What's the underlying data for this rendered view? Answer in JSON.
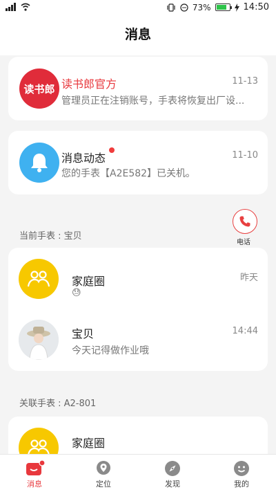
{
  "status_bar": {
    "battery": "73%",
    "time": "14:50"
  },
  "header": {
    "title": "消息"
  },
  "notices": [
    {
      "name": "读书郎官方",
      "avatar_text": "读书郎",
      "time": "11-13",
      "preview": "管理员正在注销账号，手表将恢复出厂设..."
    },
    {
      "name": "消息动态",
      "time": "11-10",
      "preview": "您的手表【A2E582】已关机。"
    }
  ],
  "current_watch": {
    "label": "当前手表 : 宝贝",
    "call_label": "电话",
    "chats": [
      {
        "name": "家庭圈",
        "time": "昨天",
        "preview": "😓"
      },
      {
        "name": "宝贝",
        "time": "14:44",
        "preview": "今天记得做作业哦"
      }
    ]
  },
  "linked_watch": {
    "label": "关联手表 : A2-801",
    "chats": [
      {
        "name": "家庭圈"
      }
    ]
  },
  "tabs": [
    {
      "label": "消息",
      "icon": "message-icon",
      "active": true
    },
    {
      "label": "定位",
      "icon": "location-icon",
      "active": false
    },
    {
      "label": "发现",
      "icon": "compass-icon",
      "active": false
    },
    {
      "label": "我的",
      "icon": "smiley-icon",
      "active": false
    }
  ],
  "colors": {
    "accent": "#e8383d",
    "brand_red": "#e02c3a",
    "bell_blue": "#3fb1f0",
    "family_yellow": "#f7c800"
  }
}
